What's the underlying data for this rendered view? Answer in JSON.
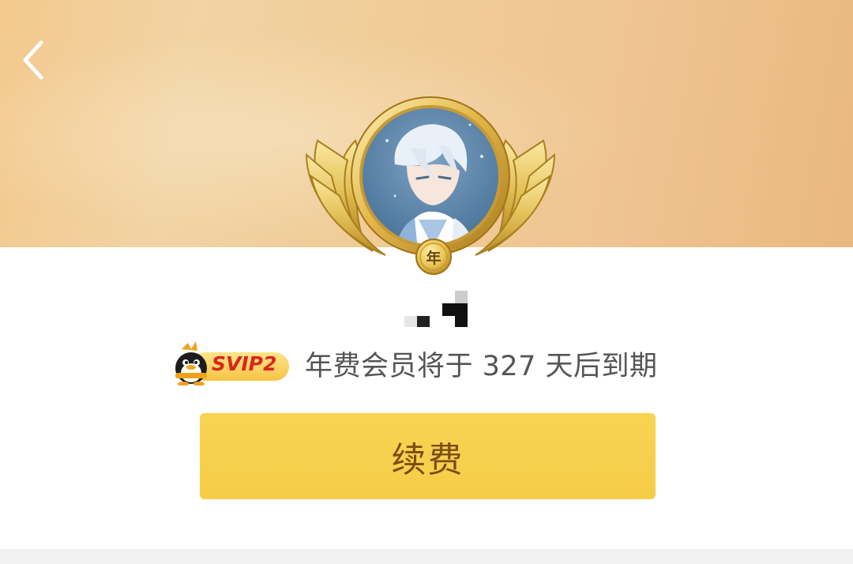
{
  "header": {
    "back_icon": "chevron-left-icon",
    "background_color": "#f0cc97"
  },
  "profile": {
    "avatar_icon": "anime-avatar",
    "medal_label": "年",
    "username": ""
  },
  "membership": {
    "badge_text": "SVIP2",
    "badge_icon": "qq-penguin-icon",
    "expiry_text": "年费会员将于 327 天后到期"
  },
  "actions": {
    "renew_label": "续费",
    "renew_color": "#f6cf4b"
  }
}
